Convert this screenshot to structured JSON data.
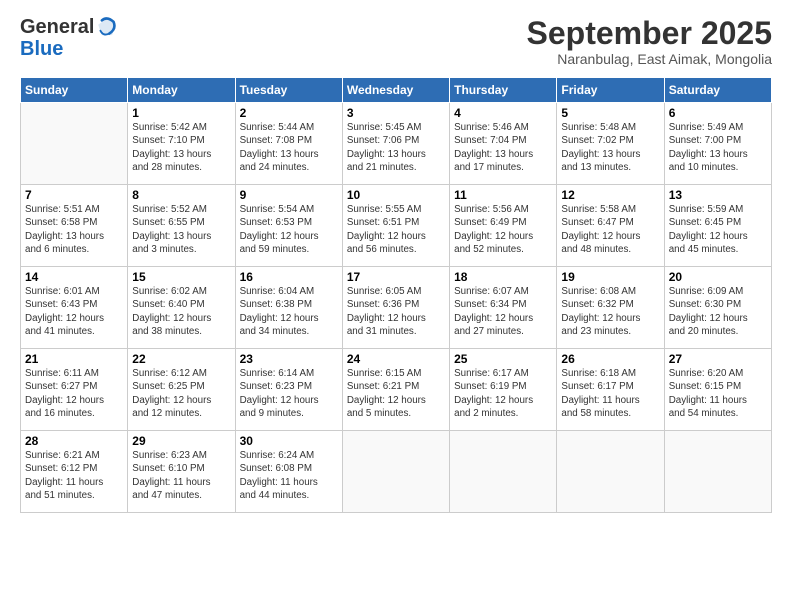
{
  "header": {
    "logo_line1": "General",
    "logo_line2": "Blue",
    "month": "September 2025",
    "location": "Naranbulag, East Aimak, Mongolia"
  },
  "days_of_week": [
    "Sunday",
    "Monday",
    "Tuesday",
    "Wednesday",
    "Thursday",
    "Friday",
    "Saturday"
  ],
  "weeks": [
    [
      {
        "day": "",
        "info": ""
      },
      {
        "day": "1",
        "info": "Sunrise: 5:42 AM\nSunset: 7:10 PM\nDaylight: 13 hours\nand 28 minutes."
      },
      {
        "day": "2",
        "info": "Sunrise: 5:44 AM\nSunset: 7:08 PM\nDaylight: 13 hours\nand 24 minutes."
      },
      {
        "day": "3",
        "info": "Sunrise: 5:45 AM\nSunset: 7:06 PM\nDaylight: 13 hours\nand 21 minutes."
      },
      {
        "day": "4",
        "info": "Sunrise: 5:46 AM\nSunset: 7:04 PM\nDaylight: 13 hours\nand 17 minutes."
      },
      {
        "day": "5",
        "info": "Sunrise: 5:48 AM\nSunset: 7:02 PM\nDaylight: 13 hours\nand 13 minutes."
      },
      {
        "day": "6",
        "info": "Sunrise: 5:49 AM\nSunset: 7:00 PM\nDaylight: 13 hours\nand 10 minutes."
      }
    ],
    [
      {
        "day": "7",
        "info": "Sunrise: 5:51 AM\nSunset: 6:58 PM\nDaylight: 13 hours\nand 6 minutes."
      },
      {
        "day": "8",
        "info": "Sunrise: 5:52 AM\nSunset: 6:55 PM\nDaylight: 13 hours\nand 3 minutes."
      },
      {
        "day": "9",
        "info": "Sunrise: 5:54 AM\nSunset: 6:53 PM\nDaylight: 12 hours\nand 59 minutes."
      },
      {
        "day": "10",
        "info": "Sunrise: 5:55 AM\nSunset: 6:51 PM\nDaylight: 12 hours\nand 56 minutes."
      },
      {
        "day": "11",
        "info": "Sunrise: 5:56 AM\nSunset: 6:49 PM\nDaylight: 12 hours\nand 52 minutes."
      },
      {
        "day": "12",
        "info": "Sunrise: 5:58 AM\nSunset: 6:47 PM\nDaylight: 12 hours\nand 48 minutes."
      },
      {
        "day": "13",
        "info": "Sunrise: 5:59 AM\nSunset: 6:45 PM\nDaylight: 12 hours\nand 45 minutes."
      }
    ],
    [
      {
        "day": "14",
        "info": "Sunrise: 6:01 AM\nSunset: 6:43 PM\nDaylight: 12 hours\nand 41 minutes."
      },
      {
        "day": "15",
        "info": "Sunrise: 6:02 AM\nSunset: 6:40 PM\nDaylight: 12 hours\nand 38 minutes."
      },
      {
        "day": "16",
        "info": "Sunrise: 6:04 AM\nSunset: 6:38 PM\nDaylight: 12 hours\nand 34 minutes."
      },
      {
        "day": "17",
        "info": "Sunrise: 6:05 AM\nSunset: 6:36 PM\nDaylight: 12 hours\nand 31 minutes."
      },
      {
        "day": "18",
        "info": "Sunrise: 6:07 AM\nSunset: 6:34 PM\nDaylight: 12 hours\nand 27 minutes."
      },
      {
        "day": "19",
        "info": "Sunrise: 6:08 AM\nSunset: 6:32 PM\nDaylight: 12 hours\nand 23 minutes."
      },
      {
        "day": "20",
        "info": "Sunrise: 6:09 AM\nSunset: 6:30 PM\nDaylight: 12 hours\nand 20 minutes."
      }
    ],
    [
      {
        "day": "21",
        "info": "Sunrise: 6:11 AM\nSunset: 6:27 PM\nDaylight: 12 hours\nand 16 minutes."
      },
      {
        "day": "22",
        "info": "Sunrise: 6:12 AM\nSunset: 6:25 PM\nDaylight: 12 hours\nand 12 minutes."
      },
      {
        "day": "23",
        "info": "Sunrise: 6:14 AM\nSunset: 6:23 PM\nDaylight: 12 hours\nand 9 minutes."
      },
      {
        "day": "24",
        "info": "Sunrise: 6:15 AM\nSunset: 6:21 PM\nDaylight: 12 hours\nand 5 minutes."
      },
      {
        "day": "25",
        "info": "Sunrise: 6:17 AM\nSunset: 6:19 PM\nDaylight: 12 hours\nand 2 minutes."
      },
      {
        "day": "26",
        "info": "Sunrise: 6:18 AM\nSunset: 6:17 PM\nDaylight: 11 hours\nand 58 minutes."
      },
      {
        "day": "27",
        "info": "Sunrise: 6:20 AM\nSunset: 6:15 PM\nDaylight: 11 hours\nand 54 minutes."
      }
    ],
    [
      {
        "day": "28",
        "info": "Sunrise: 6:21 AM\nSunset: 6:12 PM\nDaylight: 11 hours\nand 51 minutes."
      },
      {
        "day": "29",
        "info": "Sunrise: 6:23 AM\nSunset: 6:10 PM\nDaylight: 11 hours\nand 47 minutes."
      },
      {
        "day": "30",
        "info": "Sunrise: 6:24 AM\nSunset: 6:08 PM\nDaylight: 11 hours\nand 44 minutes."
      },
      {
        "day": "",
        "info": ""
      },
      {
        "day": "",
        "info": ""
      },
      {
        "day": "",
        "info": ""
      },
      {
        "day": "",
        "info": ""
      }
    ]
  ]
}
